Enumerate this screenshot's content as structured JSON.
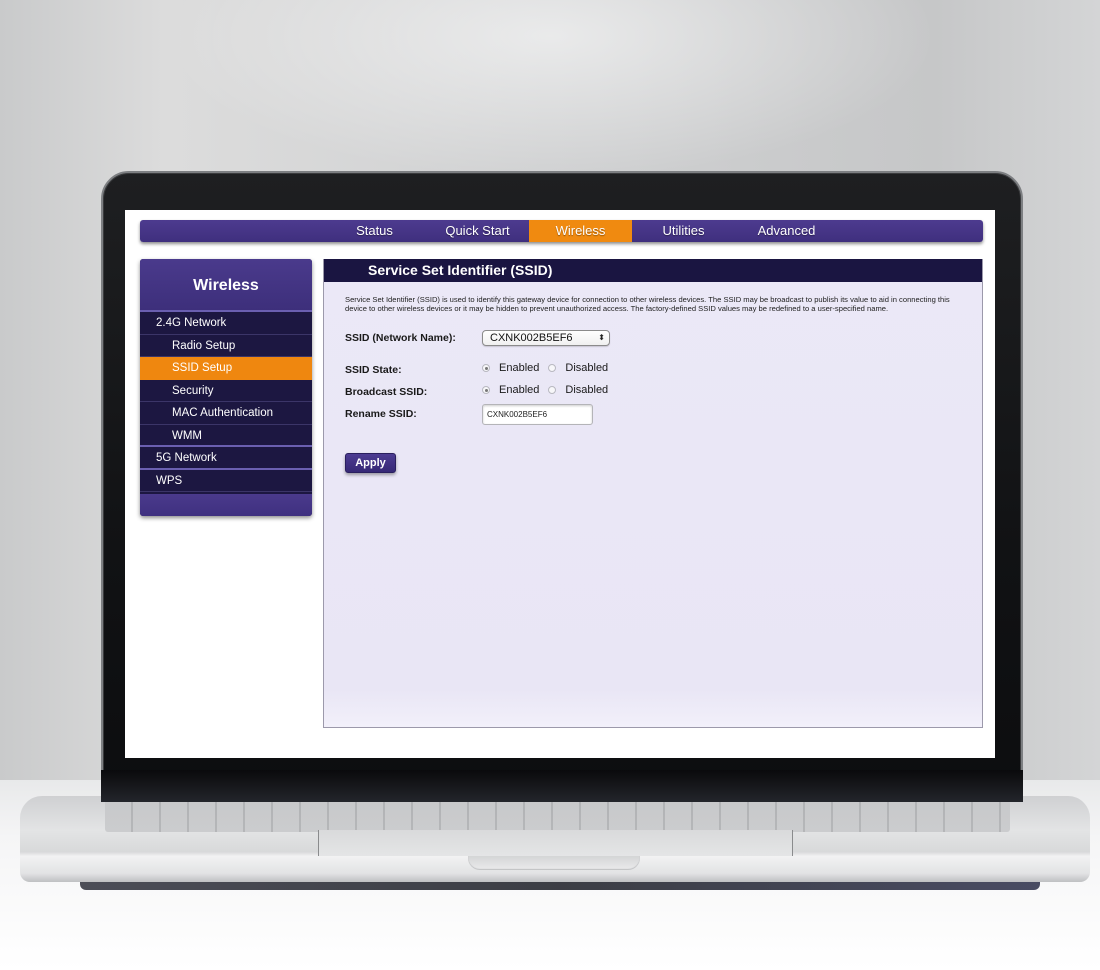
{
  "topnav": {
    "items": [
      {
        "label": "Status",
        "active": false
      },
      {
        "label": "Quick Start",
        "active": false
      },
      {
        "label": "Wireless",
        "active": true
      },
      {
        "label": "Utilities",
        "active": false
      },
      {
        "label": "Advanced",
        "active": false
      }
    ]
  },
  "sidebar": {
    "title": "Wireless",
    "items": [
      {
        "label": "2.4G Network",
        "level": 0,
        "active": false
      },
      {
        "label": "Radio Setup",
        "level": 1,
        "active": false
      },
      {
        "label": "SSID Setup",
        "level": 1,
        "active": true
      },
      {
        "label": "Security",
        "level": 1,
        "active": false
      },
      {
        "label": "MAC Authentication",
        "level": 1,
        "active": false
      },
      {
        "label": "WMM",
        "level": 1,
        "active": false
      },
      {
        "label": "5G Network",
        "level": 0,
        "active": false
      },
      {
        "label": "WPS",
        "level": 0,
        "active": false
      }
    ]
  },
  "main": {
    "title": "Service Set Identifier (SSID)",
    "description": "Service Set Identifier (SSID) is used to identify this gateway device for connection to other wireless devices. The SSID may be broadcast to publish its value to aid in connecting this device to other wireless devices or it may be hidden to prevent unauthorized access. The factory-defined SSID values may be redefined to a user-specified name.",
    "ssid_label": "SSID (Network Name):",
    "ssid_selected": "CXNK002B5EF6",
    "ssid_select_icon": "up-down-arrows-icon",
    "ssid_state": {
      "label": "SSID State:",
      "options": [
        "Enabled",
        "Disabled"
      ],
      "selected": "Enabled"
    },
    "broadcast_ssid": {
      "label": "Broadcast SSID:",
      "options": [
        "Enabled",
        "Disabled"
      ],
      "selected": "Enabled"
    },
    "rename_ssid": {
      "label": "Rename SSID:",
      "value": "CXNK002B5EF6"
    },
    "apply_label": "Apply"
  },
  "colors": {
    "nav_purple": "#3f2f7e",
    "active_orange": "#f08a10",
    "sidebar_navy": "#1c1741",
    "panel_bg": "#ebe8f7"
  }
}
